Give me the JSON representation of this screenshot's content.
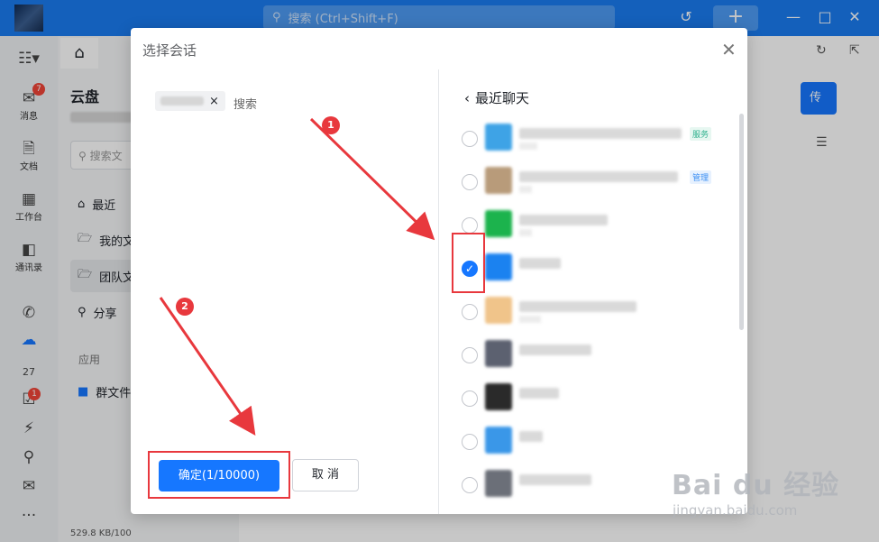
{
  "titlebar": {
    "search_placeholder": "搜索 (Ctrl+Shift+F)",
    "accent": "#1a7cf0"
  },
  "rail": {
    "items": [
      {
        "label": "消息",
        "icon": "chat-icon",
        "badge": "7"
      },
      {
        "label": "文档",
        "icon": "document-icon"
      },
      {
        "label": "工作台",
        "icon": "grid-icon"
      },
      {
        "label": "通讯录",
        "icon": "contacts-icon"
      },
      {
        "label": "",
        "icon": "phone-icon"
      },
      {
        "label": "",
        "icon": "cloud-icon"
      },
      {
        "label": "",
        "icon": "calendar-icon",
        "text": "27"
      },
      {
        "label": "",
        "icon": "todo-icon",
        "badge": "1"
      },
      {
        "label": "",
        "icon": "lightning-icon"
      },
      {
        "label": "",
        "icon": "pin-icon"
      },
      {
        "label": "",
        "icon": "mail-icon"
      },
      {
        "label": "",
        "icon": "more-icon",
        "text": "..."
      }
    ]
  },
  "cloud": {
    "title": "云盘",
    "search_placeholder": "搜索文",
    "nav": [
      "最近",
      "我的文",
      "团队文",
      "分享"
    ],
    "section_apps": "应用",
    "app_item": "群文件",
    "storage": "529.8 KB/100"
  },
  "main": {
    "upload_label": "传"
  },
  "dialog": {
    "title": "选择会话",
    "selected_chip_remove": "×",
    "search_label": "搜索",
    "recent_title": "最近聊天",
    "back_icon": "chevron-left-icon",
    "confirm_label": "确定(1/10000)",
    "cancel_label": "取 消",
    "tags": {
      "service": "服务",
      "admin": "管理"
    },
    "rows": [
      {
        "checked": false,
        "avatar_color": "#3ea3e6",
        "tag": "service"
      },
      {
        "checked": false,
        "avatar_color": "#b89b7a",
        "tag": "admin"
      },
      {
        "checked": false,
        "avatar_color": "#1cb34d",
        "tag": ""
      },
      {
        "checked": true,
        "avatar_color": "#1b82f0",
        "tag": ""
      },
      {
        "checked": false,
        "avatar_color": "#f0c48a",
        "tag": ""
      },
      {
        "checked": false,
        "avatar_color": "#5c6170",
        "tag": ""
      },
      {
        "checked": false,
        "avatar_color": "#2a2a2a",
        "tag": ""
      },
      {
        "checked": false,
        "avatar_color": "#3a97e8",
        "tag": ""
      },
      {
        "checked": false,
        "avatar_color": "#6b6f78",
        "tag": ""
      }
    ]
  },
  "annotations": {
    "marker1": "1",
    "marker2": "2",
    "color": "#e8383d"
  },
  "watermark": {
    "brand": "Bai du 经验",
    "url": "jingyan.baidu.com"
  }
}
